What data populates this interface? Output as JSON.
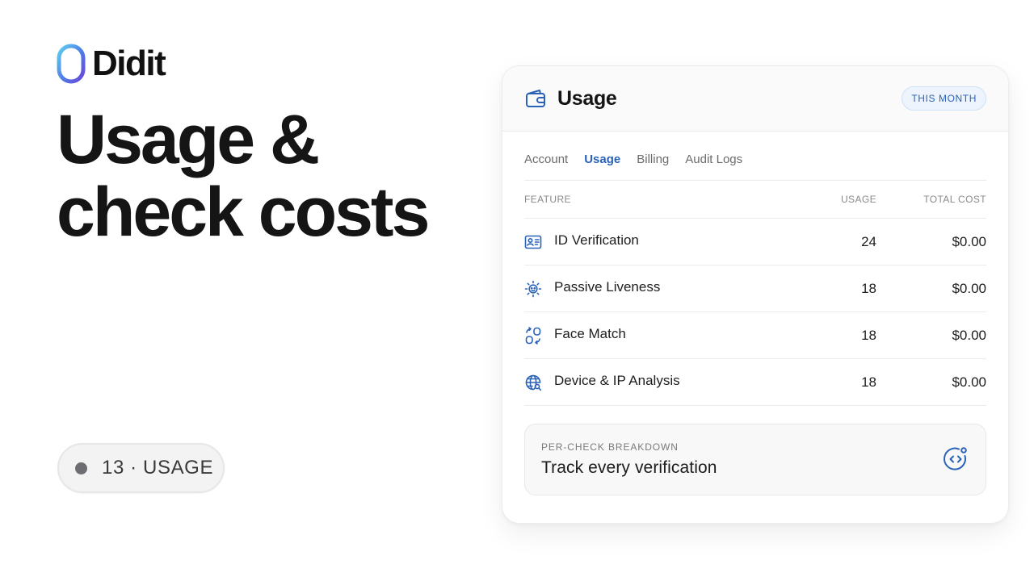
{
  "brand": {
    "name": "Didit",
    "accent": "#2a62b8"
  },
  "hero": {
    "line1": "Usage &",
    "line2": "check costs"
  },
  "step": {
    "label": "13 · USAGE"
  },
  "panel": {
    "icon": "wallet-icon",
    "title": "Usage",
    "badge": "THIS MONTH",
    "tabs": [
      {
        "label": "Account",
        "active": false
      },
      {
        "label": "Usage",
        "active": true
      },
      {
        "label": "Billing",
        "active": false
      },
      {
        "label": "Audit Logs",
        "active": false
      }
    ],
    "columns": {
      "feature": "FEATURE",
      "usage": "USAGE",
      "total_cost": "TOTAL COST"
    },
    "rows": [
      {
        "icon": "id-card-icon",
        "feature": "ID Verification",
        "usage": "24",
        "total_cost": "$0.00"
      },
      {
        "icon": "face-scan-icon",
        "feature": "Passive Liveness",
        "usage": "18",
        "total_cost": "$0.00"
      },
      {
        "icon": "face-match-icon",
        "feature": "Face Match",
        "usage": "18",
        "total_cost": "$0.00"
      },
      {
        "icon": "globe-search-icon",
        "feature": "Device & IP Analysis",
        "usage": "18",
        "total_cost": "$0.00"
      }
    ],
    "breakdown": {
      "label": "PER-CHECK BREAKDOWN",
      "title": "Track every verification",
      "icon": "code-circle-icon"
    }
  }
}
